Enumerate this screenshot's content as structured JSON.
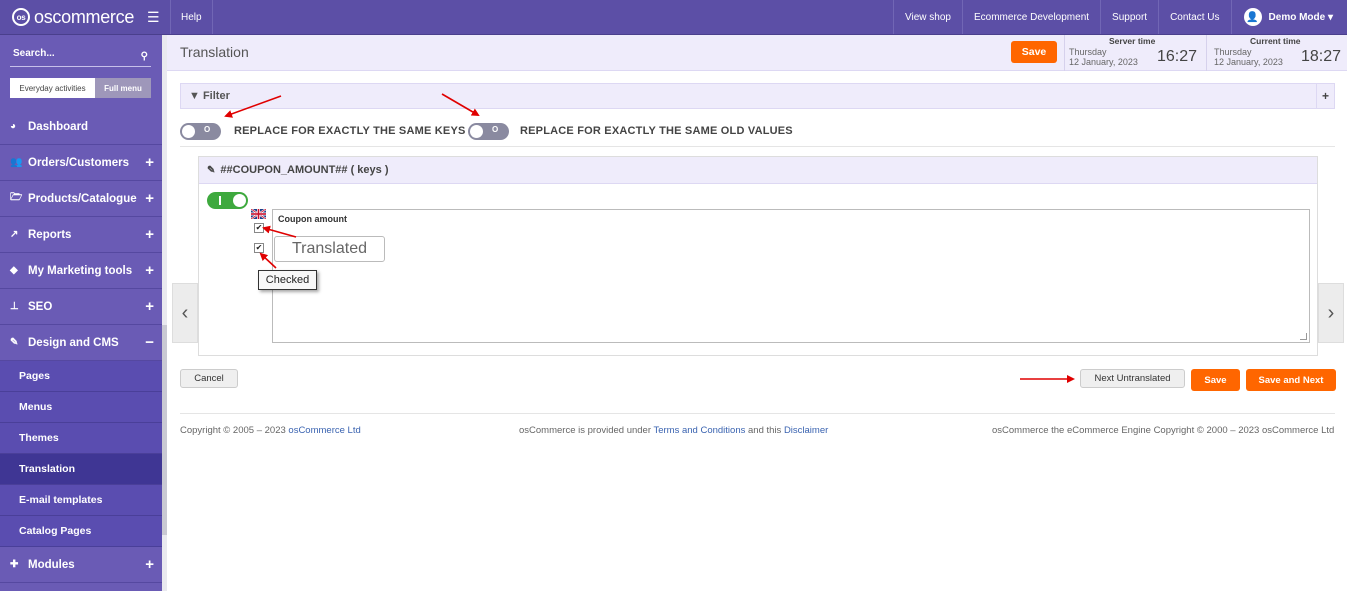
{
  "topbar": {
    "logo_text": "oscommerce",
    "logo_mark": "os",
    "help": "Help",
    "links": [
      "View shop",
      "Ecommerce Development",
      "Support",
      "Contact Us"
    ],
    "user": "Demo Mode ▾"
  },
  "sidebar": {
    "search_placeholder": "Search...",
    "toggle_everyday": "Everyday activities",
    "toggle_full": "Full menu",
    "items": [
      {
        "label": "Dashboard",
        "icon": "dashboard-icon",
        "expand": ""
      },
      {
        "label": "Orders/Customers",
        "icon": "users-icon",
        "expand": "+"
      },
      {
        "label": "Products/Catalogue",
        "icon": "folder-icon",
        "expand": "+"
      },
      {
        "label": "Reports",
        "icon": "chart-icon",
        "expand": "+"
      },
      {
        "label": "My Marketing tools",
        "icon": "tag-icon",
        "expand": "+"
      },
      {
        "label": "SEO",
        "icon": "sitemap-icon",
        "expand": "+"
      },
      {
        "label": "Design and CMS",
        "icon": "brush-icon",
        "expand": "−"
      }
    ],
    "subitems": [
      "Pages",
      "Menus",
      "Themes",
      "Translation",
      "E-mail templates",
      "Catalog Pages"
    ],
    "active_sub": "Translation",
    "modules": {
      "label": "Modules",
      "icon": "puzzle-icon",
      "expand": "+"
    }
  },
  "header": {
    "title": "Translation",
    "save": "Save",
    "server_time": {
      "label": "Server time",
      "day": "Thursday",
      "date": "12 January, 2023",
      "clock": "16:27"
    },
    "current_time": {
      "label": "Current time",
      "day": "Thursday",
      "date": "12 January, 2023",
      "clock": "18:27"
    }
  },
  "filter": {
    "label": "Filter",
    "plus": "+"
  },
  "options": {
    "toggle_text": "O",
    "replace_keys": "REPLACE FOR EXACTLY THE SAME KEYS",
    "replace_values": "REPLACE FOR EXACTLY THE SAME OLD VALUES"
  },
  "card": {
    "title": "##COUPON_AMOUNT## ( keys )",
    "field_label": "Coupon amount",
    "translated": "Translated",
    "tooltip": "Checked",
    "checkmark": "✔"
  },
  "actions": {
    "cancel": "Cancel",
    "next_untranslated": "Next Untranslated",
    "save": "Save",
    "save_next": "Save and Next"
  },
  "footer": {
    "left_text": "Copyright © 2005 – 2023 ",
    "left_link": "osCommerce Ltd",
    "mid_1": "osCommerce is provided under ",
    "mid_link1": "Terms and Conditions",
    "mid_2": " and this ",
    "mid_link2": "Disclaimer",
    "right_text": "osCommerce the eCommerce Engine Copyright © 2000 – 2023 osCommerce Ltd"
  },
  "colors": {
    "brand": "#5c4fa6",
    "accent": "#ff6600",
    "toggle_on": "#3ea93e",
    "annotation": "#e00000"
  }
}
